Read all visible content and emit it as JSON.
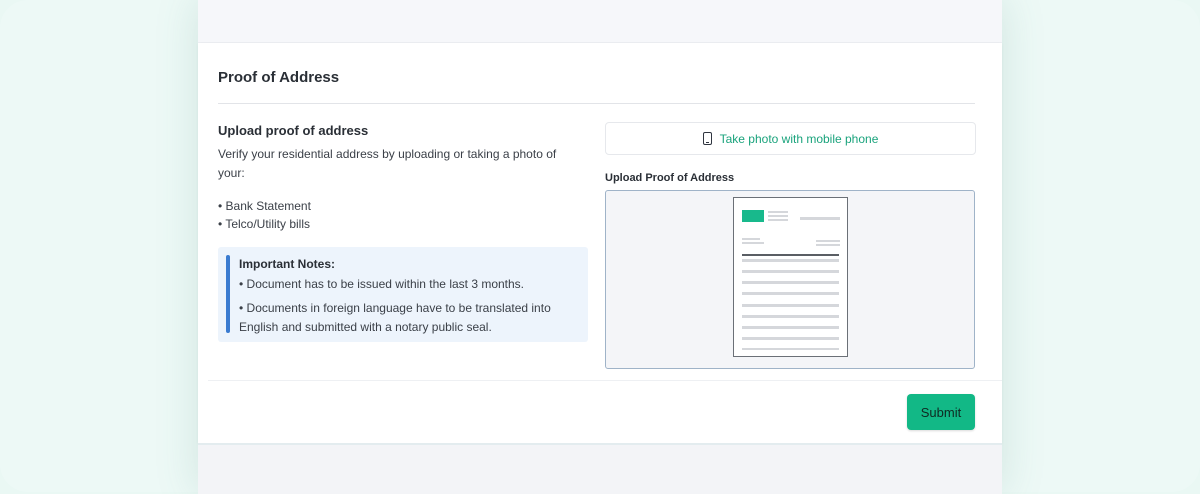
{
  "panel": {
    "title": "Proof of Address"
  },
  "instructions": {
    "heading": "Upload proof of address",
    "description": "Verify your residential address by uploading or taking a photo of your:",
    "documents": [
      "• Bank Statement",
      "• Telco/Utility bills"
    ]
  },
  "notes": {
    "title": "Important Notes:",
    "items": [
      "• Document has to be issued within the last 3 months.",
      "• Documents in foreign language have to be translated into English and submitted with a notary public seal."
    ]
  },
  "mobile": {
    "label": "Take photo with mobile phone",
    "icon": "mobile-phone-icon"
  },
  "upload": {
    "label": "Upload Proof of Address",
    "preview_icon": "document-preview"
  },
  "actions": {
    "submit_label": "Submit"
  },
  "colors": {
    "accent": "#12b886",
    "link": "#1aa37c",
    "note_bar": "#3a7bd0",
    "note_bg": "#edf4fc"
  }
}
